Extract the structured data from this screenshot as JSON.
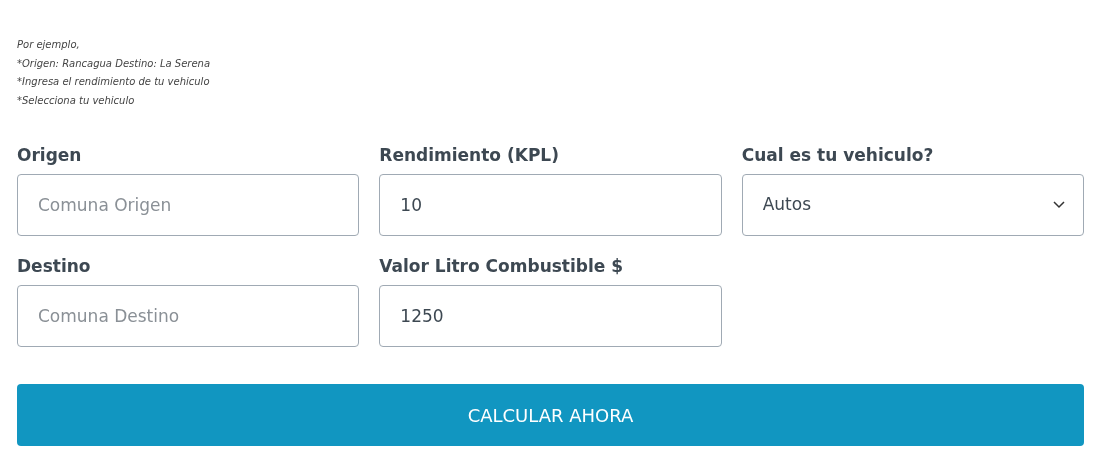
{
  "notes": [
    "Por ejemplo,",
    "*Origen: Rancagua Destino: La Serena",
    "*Ingresa el rendimiento de tu vehiculo",
    "*Selecciona tu vehiculo"
  ],
  "fields": [
    {
      "kind": "text",
      "label": "Origen",
      "placeholder": "Comuna Origen"
    },
    {
      "kind": "text",
      "label": "Rendimiento (KPL)",
      "value": "10"
    },
    {
      "kind": "select",
      "label": "Cual es tu vehiculo?",
      "value": "Autos"
    },
    {
      "kind": "text",
      "label": "Destino",
      "placeholder": "Comuna Destino"
    },
    {
      "kind": "text",
      "label": "Valor Litro Combustible $",
      "value": "1250"
    }
  ],
  "button": "CALCULAR AHORA"
}
